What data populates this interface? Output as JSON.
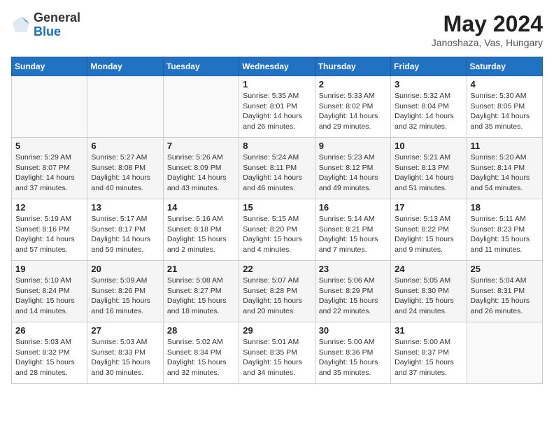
{
  "header": {
    "logo_line1": "General",
    "logo_line2": "Blue",
    "month_year": "May 2024",
    "location": "Janoshaza, Vas, Hungary"
  },
  "days_of_week": [
    "Sunday",
    "Monday",
    "Tuesday",
    "Wednesday",
    "Thursday",
    "Friday",
    "Saturday"
  ],
  "weeks": [
    [
      {
        "day": "",
        "info": ""
      },
      {
        "day": "",
        "info": ""
      },
      {
        "day": "",
        "info": ""
      },
      {
        "day": "1",
        "info": "Sunrise: 5:35 AM\nSunset: 8:01 PM\nDaylight: 14 hours\nand 26 minutes."
      },
      {
        "day": "2",
        "info": "Sunrise: 5:33 AM\nSunset: 8:02 PM\nDaylight: 14 hours\nand 29 minutes."
      },
      {
        "day": "3",
        "info": "Sunrise: 5:32 AM\nSunset: 8:04 PM\nDaylight: 14 hours\nand 32 minutes."
      },
      {
        "day": "4",
        "info": "Sunrise: 5:30 AM\nSunset: 8:05 PM\nDaylight: 14 hours\nand 35 minutes."
      }
    ],
    [
      {
        "day": "5",
        "info": "Sunrise: 5:29 AM\nSunset: 8:07 PM\nDaylight: 14 hours\nand 37 minutes."
      },
      {
        "day": "6",
        "info": "Sunrise: 5:27 AM\nSunset: 8:08 PM\nDaylight: 14 hours\nand 40 minutes."
      },
      {
        "day": "7",
        "info": "Sunrise: 5:26 AM\nSunset: 8:09 PM\nDaylight: 14 hours\nand 43 minutes."
      },
      {
        "day": "8",
        "info": "Sunrise: 5:24 AM\nSunset: 8:11 PM\nDaylight: 14 hours\nand 46 minutes."
      },
      {
        "day": "9",
        "info": "Sunrise: 5:23 AM\nSunset: 8:12 PM\nDaylight: 14 hours\nand 49 minutes."
      },
      {
        "day": "10",
        "info": "Sunrise: 5:21 AM\nSunset: 8:13 PM\nDaylight: 14 hours\nand 51 minutes."
      },
      {
        "day": "11",
        "info": "Sunrise: 5:20 AM\nSunset: 8:14 PM\nDaylight: 14 hours\nand 54 minutes."
      }
    ],
    [
      {
        "day": "12",
        "info": "Sunrise: 5:19 AM\nSunset: 8:16 PM\nDaylight: 14 hours\nand 57 minutes."
      },
      {
        "day": "13",
        "info": "Sunrise: 5:17 AM\nSunset: 8:17 PM\nDaylight: 14 hours\nand 59 minutes."
      },
      {
        "day": "14",
        "info": "Sunrise: 5:16 AM\nSunset: 8:18 PM\nDaylight: 15 hours\nand 2 minutes."
      },
      {
        "day": "15",
        "info": "Sunrise: 5:15 AM\nSunset: 8:20 PM\nDaylight: 15 hours\nand 4 minutes."
      },
      {
        "day": "16",
        "info": "Sunrise: 5:14 AM\nSunset: 8:21 PM\nDaylight: 15 hours\nand 7 minutes."
      },
      {
        "day": "17",
        "info": "Sunrise: 5:13 AM\nSunset: 8:22 PM\nDaylight: 15 hours\nand 9 minutes."
      },
      {
        "day": "18",
        "info": "Sunrise: 5:11 AM\nSunset: 8:23 PM\nDaylight: 15 hours\nand 11 minutes."
      }
    ],
    [
      {
        "day": "19",
        "info": "Sunrise: 5:10 AM\nSunset: 8:24 PM\nDaylight: 15 hours\nand 14 minutes."
      },
      {
        "day": "20",
        "info": "Sunrise: 5:09 AM\nSunset: 8:26 PM\nDaylight: 15 hours\nand 16 minutes."
      },
      {
        "day": "21",
        "info": "Sunrise: 5:08 AM\nSunset: 8:27 PM\nDaylight: 15 hours\nand 18 minutes."
      },
      {
        "day": "22",
        "info": "Sunrise: 5:07 AM\nSunset: 8:28 PM\nDaylight: 15 hours\nand 20 minutes."
      },
      {
        "day": "23",
        "info": "Sunrise: 5:06 AM\nSunset: 8:29 PM\nDaylight: 15 hours\nand 22 minutes."
      },
      {
        "day": "24",
        "info": "Sunrise: 5:05 AM\nSunset: 8:30 PM\nDaylight: 15 hours\nand 24 minutes."
      },
      {
        "day": "25",
        "info": "Sunrise: 5:04 AM\nSunset: 8:31 PM\nDaylight: 15 hours\nand 26 minutes."
      }
    ],
    [
      {
        "day": "26",
        "info": "Sunrise: 5:03 AM\nSunset: 8:32 PM\nDaylight: 15 hours\nand 28 minutes."
      },
      {
        "day": "27",
        "info": "Sunrise: 5:03 AM\nSunset: 8:33 PM\nDaylight: 15 hours\nand 30 minutes."
      },
      {
        "day": "28",
        "info": "Sunrise: 5:02 AM\nSunset: 8:34 PM\nDaylight: 15 hours\nand 32 minutes."
      },
      {
        "day": "29",
        "info": "Sunrise: 5:01 AM\nSunset: 8:35 PM\nDaylight: 15 hours\nand 34 minutes."
      },
      {
        "day": "30",
        "info": "Sunrise: 5:00 AM\nSunset: 8:36 PM\nDaylight: 15 hours\nand 35 minutes."
      },
      {
        "day": "31",
        "info": "Sunrise: 5:00 AM\nSunset: 8:37 PM\nDaylight: 15 hours\nand 37 minutes."
      },
      {
        "day": "",
        "info": ""
      }
    ]
  ]
}
